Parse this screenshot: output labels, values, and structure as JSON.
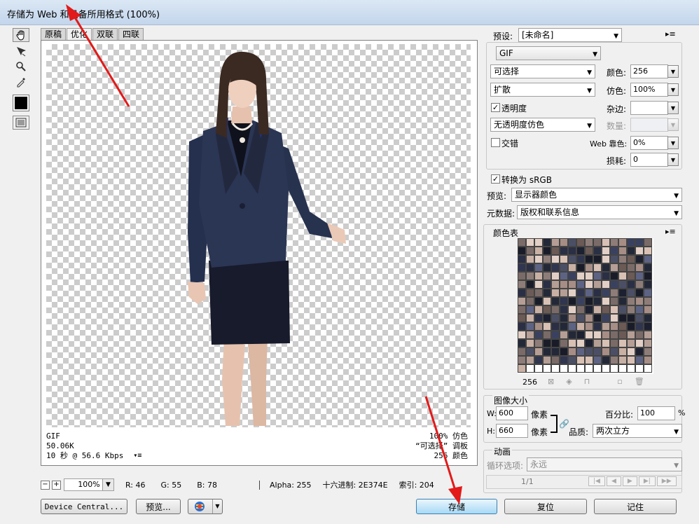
{
  "window": {
    "title": "存储为 Web 和设备所用格式 (100%)"
  },
  "tabs": [
    "原稿",
    "优化",
    "双联",
    "四联"
  ],
  "canvas_info": {
    "left": [
      "GIF",
      "50.06K",
      "10 秒 @ 56.6 Kbps"
    ],
    "right": [
      "100% 仿色",
      "“可选择” 调板",
      "256 颜色"
    ]
  },
  "status": {
    "zoom": "100%",
    "r": "R: 46",
    "g": "G: 55",
    "b": "B: 78",
    "alpha": "Alpha: 255",
    "hex": "十六进制: 2E374E",
    "index": "索引: 204"
  },
  "bottom": {
    "device_central": "Device Central...",
    "preview": "预览...",
    "save": "存储",
    "reset": "复位",
    "remember": "记住"
  },
  "settings": {
    "preset_label": "预设:",
    "preset_value": "[未命名]",
    "format": "GIF",
    "reduction": "可选择",
    "dither_algo": "扩散",
    "transparency_label": "透明度",
    "transparency_dither": "无透明度仿色",
    "interlace_label": "交错",
    "colors_label": "颜色:",
    "colors_value": "256",
    "dither_label": "仿色:",
    "dither_value": "100%",
    "matte_label": "杂边:",
    "amount_label": "数量:",
    "web_snap_label": "Web 靠色:",
    "web_snap_value": "0%",
    "lossy_label": "损耗:",
    "lossy_value": "0",
    "srgb_label": "转换为 sRGB",
    "preview_label": "预览:",
    "preview_value": "显示器颜色",
    "metadata_label": "元数据:",
    "metadata_value": "版权和联系信息"
  },
  "color_table": {
    "label": "颜色表",
    "count": "256",
    "colors": [
      "#2a2f45",
      "#6b5a55",
      "#c9b0a4",
      "#1c2030",
      "#8d7c78",
      "#3a4160",
      "#e2cfc6",
      "#4b4f66",
      "#a68d85",
      "#232838",
      "#5d6384",
      "#d8c0b4",
      "#7a6b68",
      "#30364f",
      "#b59e95",
      "#191c28"
    ]
  },
  "image_size": {
    "label": "图像大小",
    "w_label": "W:",
    "w_value": "600",
    "h_label": "H:",
    "h_value": "660",
    "unit": "像素",
    "percent_label": "百分比:",
    "percent_value": "100",
    "percent_unit": "%",
    "quality_label": "品质:",
    "quality_value": "两次立方"
  },
  "animation": {
    "label": "动画",
    "loop_label": "循环选项:",
    "loop_value": "永远",
    "frame": "1/1"
  }
}
